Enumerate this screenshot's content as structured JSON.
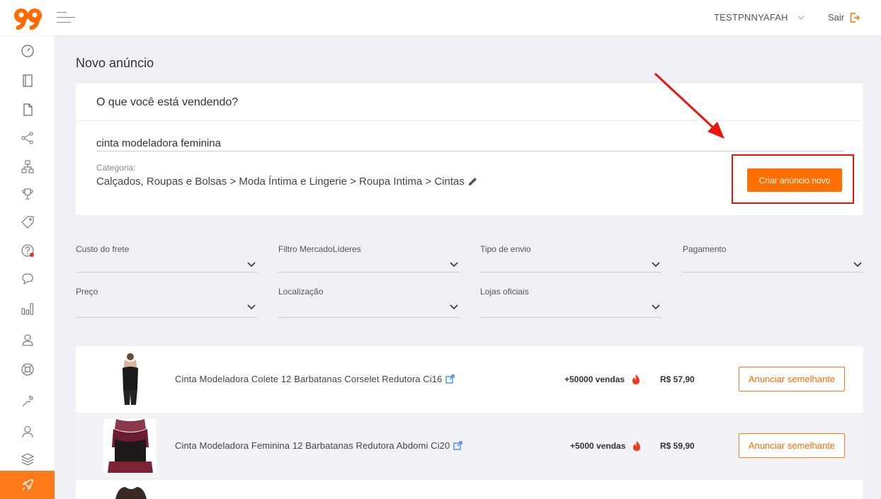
{
  "header": {
    "username": "TESTPNNYAFAH",
    "logout_label": "Sair",
    "brand_color": "#ff7000"
  },
  "sidebar": {
    "icons": [
      "dashboard-icon",
      "notebook-icon",
      "document-icon",
      "share-icon",
      "hierarchy-icon",
      "trophy-icon",
      "tag-icon",
      "help-icon",
      "chat-icon",
      "bar-chart-icon",
      "users-icon",
      "lifebuoy-icon",
      "wrench-icon",
      "user-icon",
      "layers-icon",
      "rocket-icon"
    ],
    "active": "rocket-icon"
  },
  "page": {
    "title": "Novo anúncio",
    "question": "O que você está vendendo?",
    "search_value": "cinta modeladora feminina",
    "category_label": "Categoria:",
    "category_path": "Calçados, Roupas e Bolsas > Moda Íntima e Lingerie > Roupa Intima > Cintas",
    "create_button": "Criar anúncio novo"
  },
  "filters": [
    {
      "label": "Custo do frete",
      "value": ""
    },
    {
      "label": "Filtro MercadoLíderes",
      "value": ""
    },
    {
      "label": "Tipo de envio",
      "value": ""
    },
    {
      "label": "Pagamento",
      "value": ""
    },
    {
      "label": "Preço",
      "value": ""
    },
    {
      "label": "Localização",
      "value": ""
    },
    {
      "label": "Lojas oficiais",
      "value": ""
    }
  ],
  "products": [
    {
      "title": "Cinta Modeladora Colete 12 Barbatanas Corselet Redutora Ci16",
      "sales": "+50000 vendas",
      "price": "R$ 57,90",
      "button": "Anunciar semelhante"
    },
    {
      "title": "Cinta Modeladora Feminina 12 Barbatanas Redutora Abdomi Ci20",
      "sales": "+5000 vendas",
      "price": "R$ 59,90",
      "button": "Anunciar semelhante"
    }
  ]
}
